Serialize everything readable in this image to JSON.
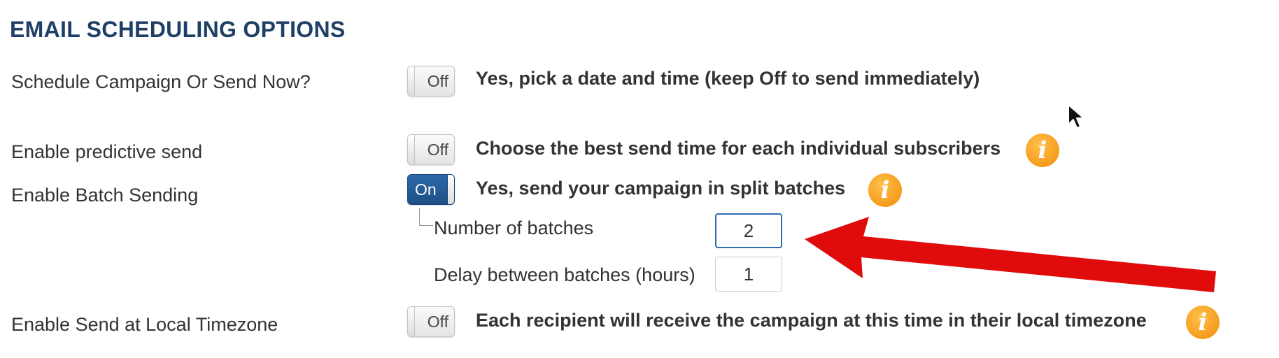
{
  "section_title": "EMAIL SCHEDULING OPTIONS",
  "rows": {
    "schedule": {
      "label": "Schedule Campaign Or Send Now?",
      "toggle": "Off",
      "description": "Yes, pick a date and time (keep Off to send immediately)"
    },
    "predictive": {
      "label": "Enable predictive send",
      "toggle": "Off",
      "description": "Choose the best send time for each individual subscribers"
    },
    "batch": {
      "label": "Enable Batch Sending",
      "toggle": "On",
      "description": "Yes, send your campaign in split batches"
    },
    "timezone": {
      "label": "Enable Send at Local Timezone",
      "toggle": "Off",
      "description": "Each recipient will receive the campaign at this time in their local timezone"
    }
  },
  "batch_settings": {
    "number_label": "Number of batches",
    "number_value": "2",
    "delay_label": "Delay between batches (hours)",
    "delay_value": "1"
  },
  "colors": {
    "title": "#1f3f66",
    "toggle_on": "#1d4f85",
    "info_icon": "#f28c0a",
    "annotation_arrow": "#e00b0b"
  }
}
